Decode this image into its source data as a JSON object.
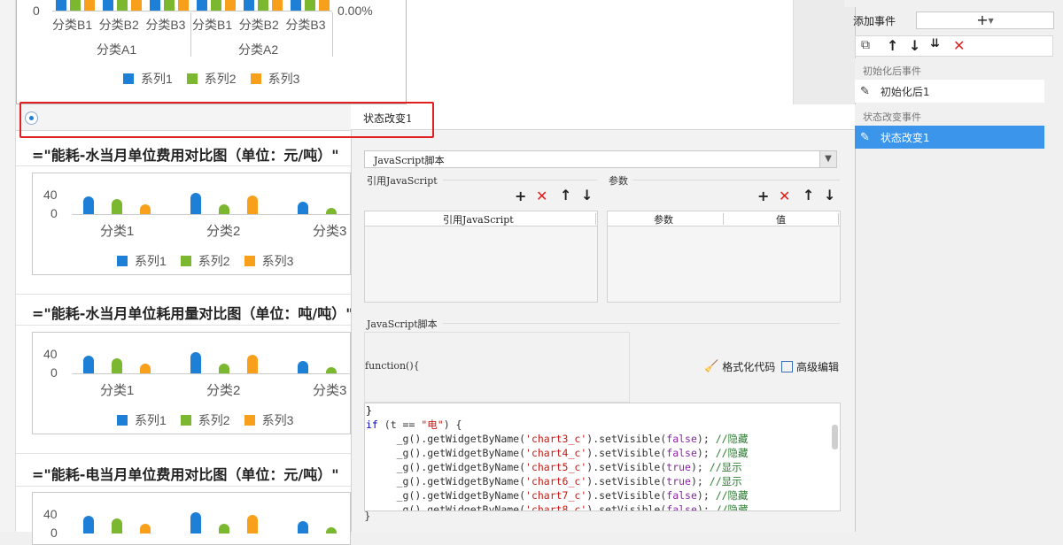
{
  "colors": {
    "series1": "#1e7fd6",
    "series2": "#7cb82f",
    "series3": "#f8a01c",
    "accent": "#3b95ea",
    "highlight_box": "#e02020"
  },
  "legend": [
    "系列1",
    "系列2",
    "系列3"
  ],
  "top_chart": {
    "y_tick_zero": "0",
    "right_tick": "0.00%",
    "categories_level2": [
      "分类B1",
      "分类B2",
      "分类B3",
      "分类B1",
      "分类B2",
      "分类B3"
    ],
    "categories_level1": [
      "分类A1",
      "分类A2"
    ]
  },
  "charts": [
    {
      "formula": "=\"能耗-水当月单位费用对比图（单位：元/吨）\"",
      "y_ticks": [
        "40",
        "0"
      ],
      "categories": [
        "分类1",
        "分类2",
        "分类3"
      ]
    },
    {
      "formula": "=\"能耗-水当月单位耗用量对比图（单位：吨/吨）\"",
      "y_ticks": [
        "40",
        "0"
      ],
      "categories": [
        "分类1",
        "分类2",
        "分类3"
      ]
    },
    {
      "formula": "=\"能耗-电当月单位费用对比图（单位：元/吨）\"",
      "y_ticks": [
        "40",
        "0"
      ],
      "categories": []
    }
  ],
  "chart_data": [
    {
      "type": "bar",
      "categories": [
        "分类1",
        "分类2",
        "分类3"
      ],
      "series": [
        {
          "name": "系列1",
          "values": [
            28,
            34,
            20
          ]
        },
        {
          "name": "系列2",
          "values": [
            24,
            16,
            10
          ]
        },
        {
          "name": "系列3",
          "values": [
            16,
            30,
            0
          ]
        }
      ],
      "ylim": [
        0,
        40
      ]
    },
    {
      "type": "bar",
      "categories": [
        "分类1",
        "分类2",
        "分类3"
      ],
      "series": [
        {
          "name": "系列1",
          "values": [
            28,
            34,
            20
          ]
        },
        {
          "name": "系列2",
          "values": [
            24,
            16,
            10
          ]
        },
        {
          "name": "系列3",
          "values": [
            16,
            30,
            0
          ]
        }
      ],
      "ylim": [
        0,
        40
      ]
    }
  ],
  "editor": {
    "tab_title": "状态改变1",
    "script_type": "JavaScript脚本",
    "ref_js_label": "引用JavaScript",
    "params_label": "参数",
    "ref_js_col": "引用JavaScript",
    "param_col": "参数",
    "value_col": "值",
    "js_section_label": "JavaScript脚本",
    "function_sig": "function(){",
    "format_code": "格式化代码",
    "advanced_edit": "高级编辑",
    "code_lines": [
      {
        "parts": [
          {
            "c": "brk",
            "t": "}"
          }
        ]
      },
      {
        "parts": [
          {
            "c": "kw",
            "t": "if"
          },
          {
            "c": "fn",
            "t": " (t == "
          },
          {
            "c": "str",
            "t": "\"电\""
          },
          {
            "c": "fn",
            "t": ") {"
          }
        ]
      },
      {
        "parts": [
          {
            "c": "fn",
            "t": "     _g().getWidgetByName("
          },
          {
            "c": "str",
            "t": "'chart3_c'"
          },
          {
            "c": "fn",
            "t": ").setVisible("
          },
          {
            "c": "bool",
            "t": "false"
          },
          {
            "c": "fn",
            "t": "); "
          },
          {
            "c": "cm",
            "t": "//隐藏"
          }
        ]
      },
      {
        "parts": [
          {
            "c": "fn",
            "t": "     _g().getWidgetByName("
          },
          {
            "c": "str",
            "t": "'chart4_c'"
          },
          {
            "c": "fn",
            "t": ").setVisible("
          },
          {
            "c": "bool",
            "t": "false"
          },
          {
            "c": "fn",
            "t": "); "
          },
          {
            "c": "cm",
            "t": "//隐藏"
          }
        ]
      },
      {
        "parts": [
          {
            "c": "fn",
            "t": "     _g().getWidgetByName("
          },
          {
            "c": "str",
            "t": "'chart5_c'"
          },
          {
            "c": "fn",
            "t": ").setVisible("
          },
          {
            "c": "bool",
            "t": "true"
          },
          {
            "c": "fn",
            "t": "); "
          },
          {
            "c": "cm",
            "t": "//显示"
          }
        ]
      },
      {
        "parts": [
          {
            "c": "fn",
            "t": "     _g().getWidgetByName("
          },
          {
            "c": "str",
            "t": "'chart6_c'"
          },
          {
            "c": "fn",
            "t": ").setVisible("
          },
          {
            "c": "bool",
            "t": "true"
          },
          {
            "c": "fn",
            "t": "); "
          },
          {
            "c": "cm",
            "t": "//显示"
          }
        ]
      },
      {
        "parts": [
          {
            "c": "fn",
            "t": "     _g().getWidgetByName("
          },
          {
            "c": "str",
            "t": "'chart7_c'"
          },
          {
            "c": "fn",
            "t": ").setVisible("
          },
          {
            "c": "bool",
            "t": "false"
          },
          {
            "c": "fn",
            "t": "); "
          },
          {
            "c": "cm",
            "t": "//隐藏"
          }
        ]
      },
      {
        "parts": [
          {
            "c": "fn",
            "t": "     _g().getWidgetByName("
          },
          {
            "c": "str",
            "t": "'chart8_c'"
          },
          {
            "c": "fn",
            "t": ").setVisible("
          },
          {
            "c": "bool",
            "t": "false"
          },
          {
            "c": "fn",
            "t": "); "
          },
          {
            "c": "cm",
            "t": "//隐藏"
          }
        ]
      },
      {
        "parts": [
          {
            "c": "brk",
            "t": "}"
          }
        ]
      }
    ]
  },
  "events_panel": {
    "add_event_label": "添加事件",
    "add_icon": "+",
    "toolbar_icons": [
      "copy-icon",
      "arrow-up-icon",
      "arrow-down-icon",
      "sort-icon",
      "delete-icon"
    ],
    "categories": [
      {
        "title": "初始化后事件",
        "items": [
          "初始化后1"
        ]
      },
      {
        "title": "状态改变事件",
        "items": [
          "状态改变1"
        ]
      }
    ]
  }
}
